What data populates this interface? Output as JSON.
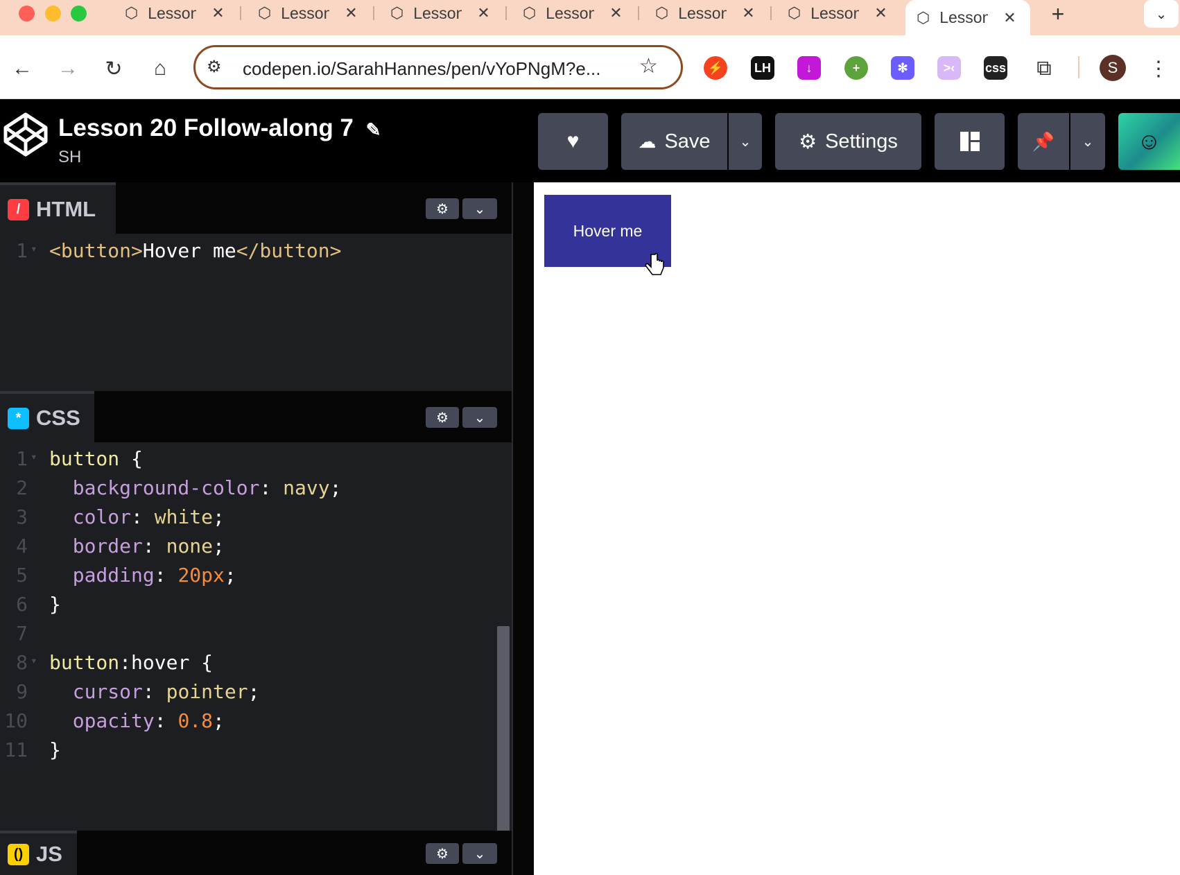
{
  "browser": {
    "tabs": [
      {
        "label": "Lesson"
      },
      {
        "label": "Lesson"
      },
      {
        "label": "Lesson"
      },
      {
        "label": "Lesson"
      },
      {
        "label": "Lesson"
      },
      {
        "label": "Lesson"
      },
      {
        "label": "Lesson",
        "active": true
      }
    ],
    "new_tab": "+",
    "url": "codepen.io/SarahHannes/pen/vYoPNgM?e...",
    "profile_initial": "S",
    "extensions": [
      {
        "name": "lighthouse-ext",
        "color": "#f4431e",
        "glyph": "⚡"
      },
      {
        "name": "lh-ext",
        "color": "#111111",
        "glyph": "LH"
      },
      {
        "name": "download-ext",
        "color": "#c418d9",
        "glyph": "↓"
      },
      {
        "name": "add-ext",
        "color": "#5ba33a",
        "glyph": "+"
      },
      {
        "name": "asterisk-ext",
        "color": "#6b5cff",
        "glyph": "✻"
      },
      {
        "name": "face-ext",
        "color": "#d9b8f7",
        "glyph": ">‹"
      },
      {
        "name": "css-ext",
        "color": "#222222",
        "glyph": "css"
      }
    ]
  },
  "codepen": {
    "title": "Lesson 20 Follow-along 7",
    "user": "SH",
    "save_label": "Save",
    "settings_label": "Settings"
  },
  "editors": {
    "html": {
      "name": "HTML",
      "lines": [
        {
          "n": "1",
          "text": "<button>Hover me</button>"
        }
      ]
    },
    "css": {
      "name": "CSS",
      "lines": [
        {
          "n": "1",
          "text": "button {"
        },
        {
          "n": "2",
          "text": "  background-color: navy;"
        },
        {
          "n": "3",
          "text": "  color: white;"
        },
        {
          "n": "4",
          "text": "  border: none;"
        },
        {
          "n": "5",
          "text": "  padding: 20px;"
        },
        {
          "n": "6",
          "text": "}"
        },
        {
          "n": "7",
          "text": ""
        },
        {
          "n": "8",
          "text": "button:hover {"
        },
        {
          "n": "9",
          "text": "  cursor: pointer;"
        },
        {
          "n": "10",
          "text": "  opacity: 0.8;"
        },
        {
          "n": "11",
          "text": "}"
        }
      ]
    },
    "js": {
      "name": "JS"
    }
  },
  "preview": {
    "button_label": "Hover me",
    "button_color": "#333399"
  },
  "colors": {
    "tag": "#e3c07f",
    "property": "#c79fdc",
    "value": "#e6d494",
    "number": "#f58d3d",
    "selector": "#f0e9a0"
  }
}
